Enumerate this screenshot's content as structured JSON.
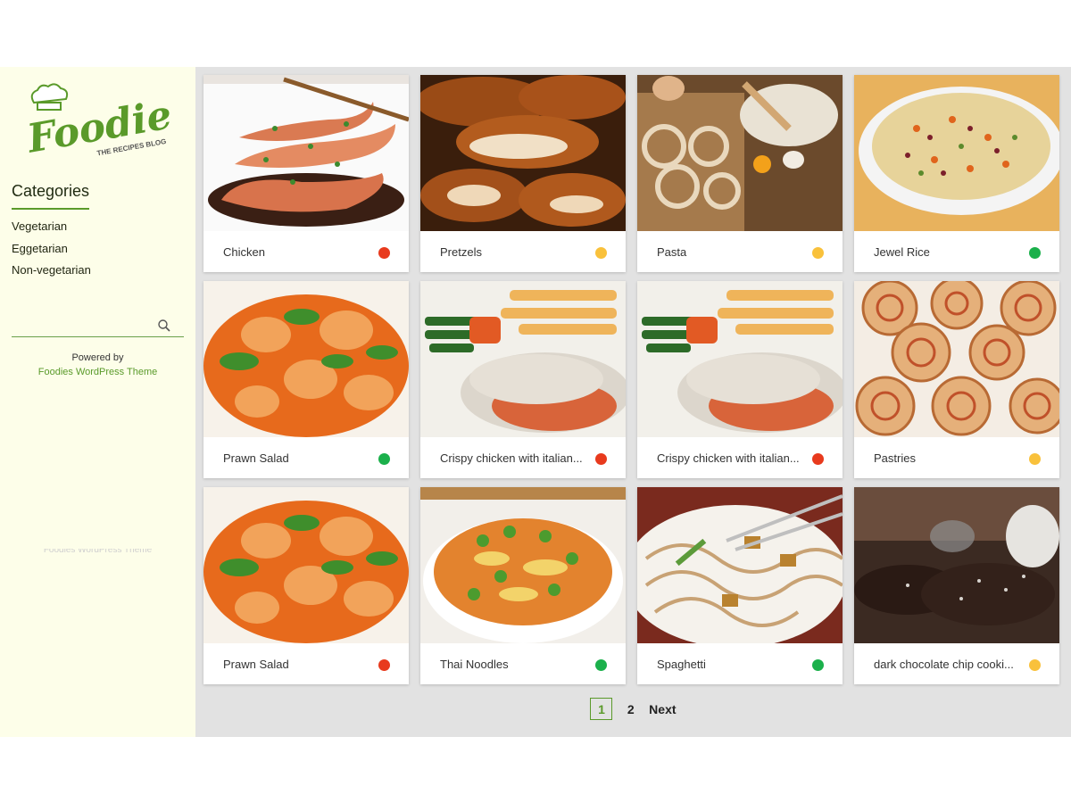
{
  "colors": {
    "accent": "#5a9a2a",
    "sidebar_bg": "#fdfee9",
    "main_bg": "#e2e2e2",
    "red": "#e83a1d",
    "yellow": "#f9c13b",
    "green": "#1bb04b"
  },
  "sidebar": {
    "logo": {
      "name": "Foodies",
      "tagline": "THE RECIPES BLOG"
    },
    "categories_title": "Categories",
    "categories": [
      "Vegetarian",
      "Eggetarian",
      "Non-vegetarian"
    ],
    "search": {
      "value": "",
      "placeholder": "",
      "icon": "search-icon"
    },
    "powered_by": "Powered by",
    "theme_link": "Foodies WordPress Theme",
    "faded_text": "Foodies WordPress Theme"
  },
  "recipes": [
    {
      "title": "Chicken",
      "status": "red"
    },
    {
      "title": "Pretzels",
      "status": "yellow"
    },
    {
      "title": "Pasta",
      "status": "yellow"
    },
    {
      "title": "Jewel Rice",
      "status": "green"
    },
    {
      "title": "Prawn Salad",
      "status": "green"
    },
    {
      "title": "Crispy chicken with italian...",
      "status": "red"
    },
    {
      "title": "Crispy chicken with italian...",
      "status": "red"
    },
    {
      "title": "Pastries",
      "status": "yellow"
    },
    {
      "title": "Prawn Salad",
      "status": "red"
    },
    {
      "title": "Thai Noodles",
      "status": "green"
    },
    {
      "title": "Spaghetti",
      "status": "green"
    },
    {
      "title": "dark chocolate chip cooki...",
      "status": "yellow"
    }
  ],
  "pagination": {
    "current": "1",
    "page2": "2",
    "next": "Next"
  }
}
